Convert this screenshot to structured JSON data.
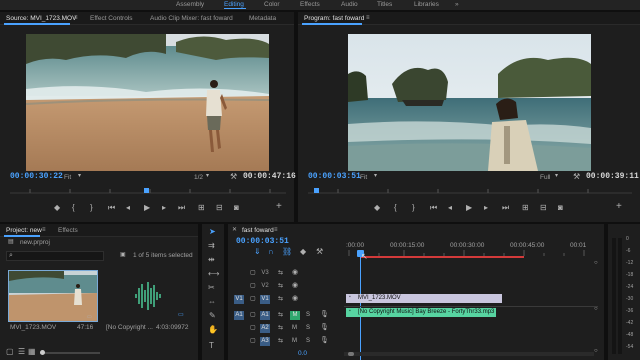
{
  "workspaces": {
    "items": [
      "Assembly",
      "Editing",
      "Color",
      "Effects",
      "Audio",
      "Titles",
      "Libraries"
    ],
    "active_index": 1
  },
  "source_panel": {
    "tabs": [
      "Source: MVI_1723.MOV",
      "Effect Controls",
      "Audio Clip Mixer: fast foward",
      "Metadata"
    ],
    "timecode": "00:00:30:22",
    "fit": "Fit",
    "resolution": "1/2",
    "duration": "00:00:47:16"
  },
  "program_panel": {
    "title": "Program: fast foward",
    "timecode": "00:00:03:51",
    "fit": "Fit",
    "resolution": "Full",
    "duration": "00:00:39:11"
  },
  "project_panel": {
    "tabs": [
      "Project: new",
      "Effects"
    ],
    "file": "new.prproj",
    "selected_info": "1 of 5 items selected",
    "items": [
      {
        "name": "MVI_1723.MOV",
        "duration": "47:16"
      },
      {
        "name": "[No Copyright ...",
        "duration": "4:03:09972"
      }
    ]
  },
  "timeline_panel": {
    "title": "fast foward",
    "timecode": "00:00:03:51",
    "ruler": [
      ":00:00",
      "00:00:15:00",
      "00:00:30:00",
      "00:00:45:00",
      "00:01"
    ],
    "tracks": {
      "video": [
        {
          "name": "V3",
          "source": ""
        },
        {
          "name": "V2",
          "source": ""
        },
        {
          "name": "V1",
          "source": "V1"
        }
      ],
      "audio": [
        {
          "name": "A1",
          "source": "A1"
        },
        {
          "name": "A2",
          "source": ""
        },
        {
          "name": "A3",
          "source": ""
        }
      ],
      "mix_value": "0.0"
    },
    "clips": {
      "video": "MVI_1723.MOV",
      "audio": "[No Copyright Music] Bay Breeze - FortyThr33.mp3"
    }
  },
  "meter_scale": [
    "0",
    "-6",
    "-12",
    "-18",
    "-24",
    "-30",
    "-36",
    "-42",
    "-48",
    "-54"
  ],
  "colors": {
    "accent": "#4aa2ff",
    "video_clip": "#c9c6de",
    "audio_clip": "#57d4a1",
    "work_area": "#d33a3a"
  }
}
